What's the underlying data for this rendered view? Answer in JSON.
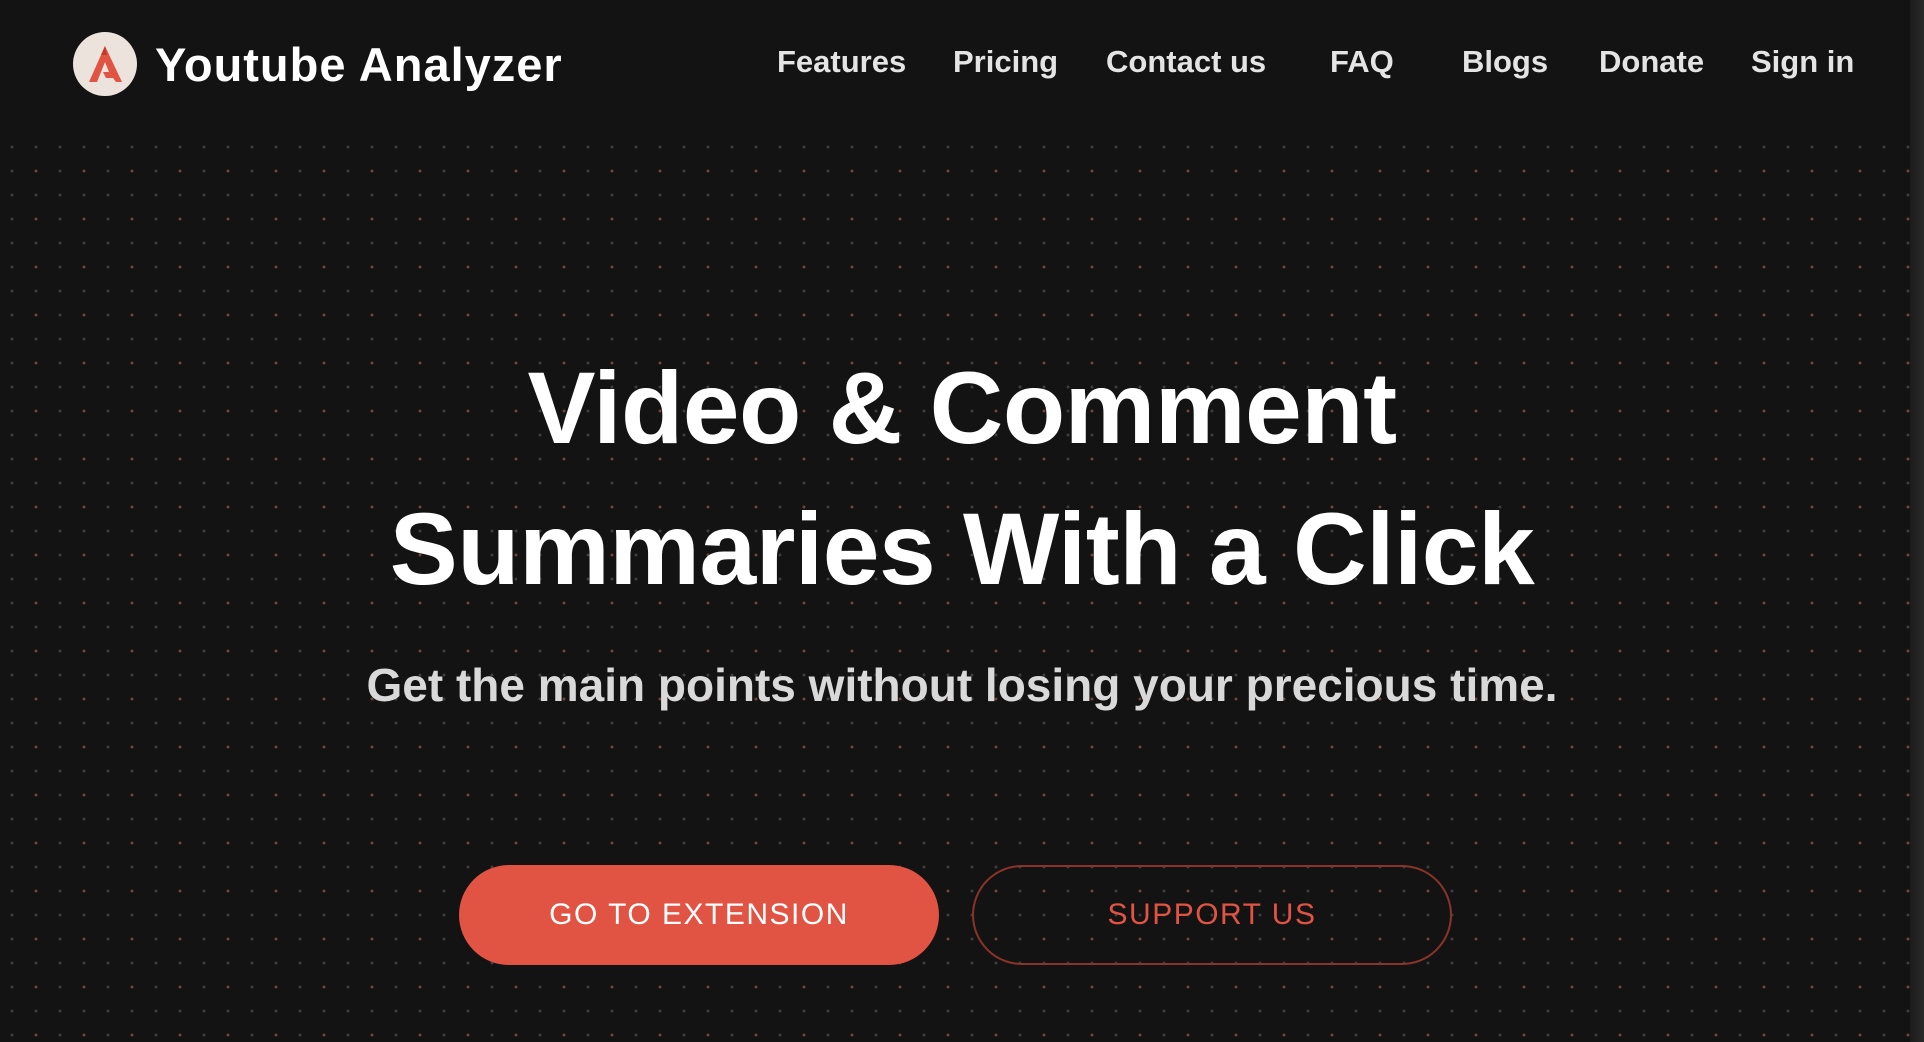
{
  "header": {
    "brand_name": "Youtube Analyzer",
    "logo_icon": "analyzer-logo-icon",
    "nav": [
      {
        "label": "Features"
      },
      {
        "label": "Pricing"
      },
      {
        "label": "Contact us"
      },
      {
        "label": "FAQ"
      },
      {
        "label": "Blogs"
      },
      {
        "label": "Donate"
      },
      {
        "label": "Sign in"
      }
    ]
  },
  "hero": {
    "headline_line1": "Video & Comment",
    "headline_line2": "Summaries With a Click",
    "subtitle": "Get the main points without losing your precious time.",
    "primary_button": "GO TO EXTENSION",
    "secondary_button": "SUPPORT US"
  },
  "colors": {
    "background": "#131313",
    "accent": "#e15342",
    "nav_text": "#e4e4e4",
    "subtitle_text": "#d9d9d9"
  }
}
